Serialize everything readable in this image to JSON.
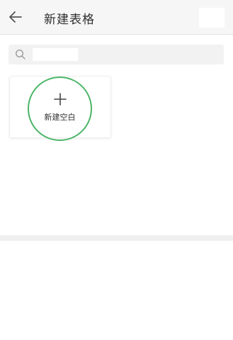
{
  "header": {
    "title": "新建表格",
    "back_icon": "arrow-left-icon"
  },
  "search": {
    "icon": "search-icon",
    "placeholder": ""
  },
  "templates": {
    "new_blank_label": "新建空白",
    "new_blank_icon": "plus-icon"
  },
  "colors": {
    "accent": "#4bb567",
    "header_bg": "#f6f6f6",
    "search_bg": "#f2f2f2",
    "divider": "#efefef"
  }
}
